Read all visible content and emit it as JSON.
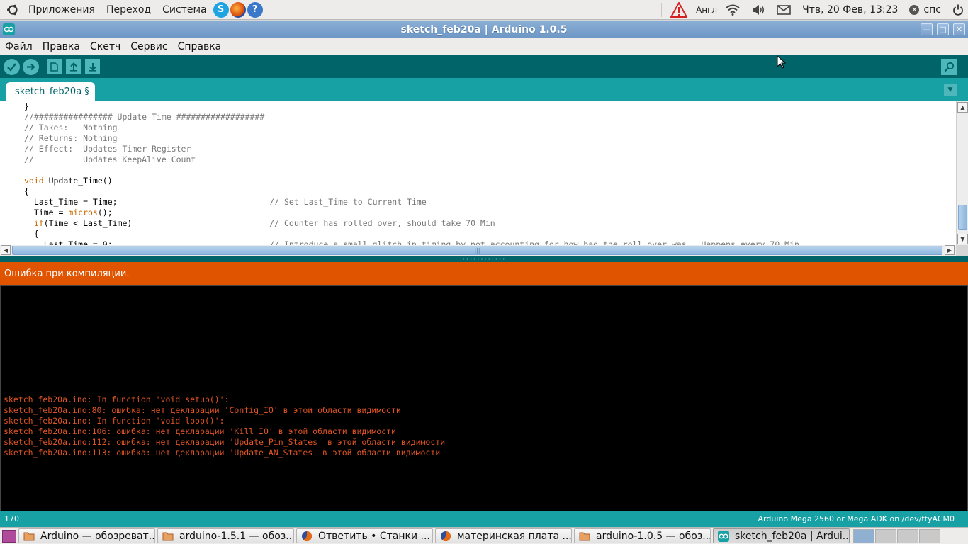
{
  "top_panel": {
    "menus": [
      "Приложения",
      "Переход",
      "Система"
    ],
    "keyboard_layout": "Англ",
    "datetime": "Чтв, 20 Фев, 13:23",
    "user": "спс"
  },
  "window": {
    "title": "sketch_feb20a | Arduino 1.0.5"
  },
  "menubar": [
    "Файл",
    "Правка",
    "Скетч",
    "Сервис",
    "Справка"
  ],
  "tab": {
    "label": "sketch_feb20a §"
  },
  "editor": {
    "lines": [
      "}",
      "//################ Update Time ##################",
      "// Takes:   Nothing",
      "// Returns: Nothing",
      "// Effect:  Updates Timer Register",
      "//          Updates KeepAlive Count",
      "",
      "void Update_Time()",
      "{",
      "  Last_Time = Time;                               // Set Last_Time to Current Time",
      "  Time = micros();",
      "  if(Time < Last_Time)                            // Counter has rolled over, should take 70 Min",
      "  {",
      "    Last_Time = 0;                                // Introduce a small glitch in timing by not accounting for how bad the roll over was.  Happens every 70 Min"
    ]
  },
  "status": {
    "message": "Ошибка при компиляции."
  },
  "console": {
    "lines": [
      "sketch_feb20a.ino: In function 'void setup()':",
      "sketch_feb20a.ino:80: ошибка: нет декларации 'Config_IO' в этой области видимости",
      "sketch_feb20a.ino: In function 'void loop()':",
      "sketch_feb20a.ino:106: ошибка: нет декларации 'Kill_IO' в этой области видимости",
      "sketch_feb20a.ino:112: ошибка: нет декларации 'Update_Pin_States' в этой области видимости",
      "sketch_feb20a.ino:113: ошибка: нет декларации 'Update_AN_States' в этой области видимости"
    ]
  },
  "footer": {
    "line_number": "170",
    "board": "Arduino Mega 2560 or Mega ADK on /dev/ttyACM0"
  },
  "taskbar": {
    "tasks": [
      {
        "label": "Arduino — обозреват...",
        "icon": "folder-icon",
        "active": false
      },
      {
        "label": "arduino-1.5.1 — обоз...",
        "icon": "folder-icon",
        "active": false
      },
      {
        "label": "Ответить • Станки ...",
        "icon": "firefox-icon",
        "active": false
      },
      {
        "label": "материнская плата ...",
        "icon": "firefox-icon",
        "active": false
      },
      {
        "label": "arduino-1.0.5 — обоз...",
        "icon": "folder-icon",
        "active": false
      },
      {
        "label": "sketch_feb20a | Ardui...",
        "icon": "arduino-icon",
        "active": true
      }
    ]
  },
  "colors": {
    "toolbar": "#006468",
    "tabbar": "#17a1a5",
    "error_bar": "#e05400",
    "console_text": "#e05424"
  }
}
